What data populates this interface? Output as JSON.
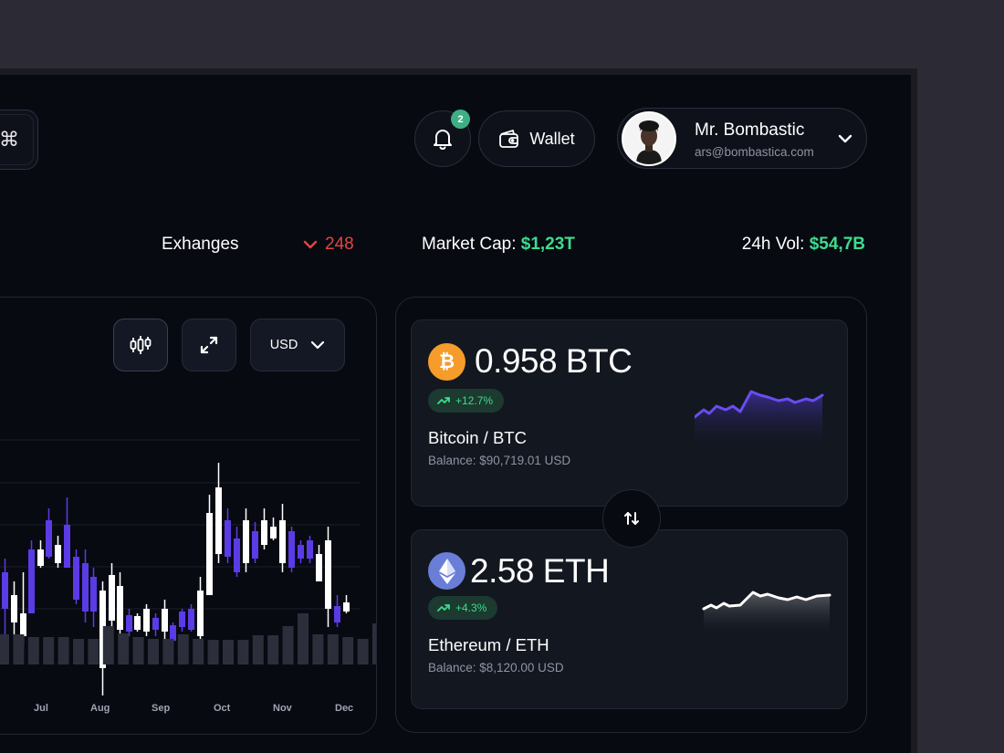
{
  "header": {
    "command_icon": "⌘",
    "notifications": {
      "icon": "bell-icon",
      "count": "2"
    },
    "wallet": {
      "icon": "wallet-icon",
      "label": "Wallet"
    },
    "user": {
      "name": "Mr. Bombastic",
      "email": "ars@bombastica.com",
      "icon": "chevron-down-icon"
    }
  },
  "stats": {
    "exchanges_label": "Exhanges",
    "exchanges_value": "248",
    "exchanges_trend": "down",
    "market_cap_label": "Market Cap:",
    "market_cap_value": "$1,23T",
    "volume_label": "24h Vol:",
    "volume_value": "$54,7B"
  },
  "chart_toolbar": {
    "chart_type_icon": "candlestick-icon",
    "expand_icon": "expand-icon",
    "currency": "USD"
  },
  "chart_data": {
    "type": "candlestick",
    "categories": [
      "Jul",
      "Aug",
      "Sep",
      "Oct",
      "Nov",
      "Dec"
    ],
    "colors": {
      "up": "#ffffff",
      "down": "#5b3be6",
      "volume": "#2c2f3b"
    }
  },
  "coins": [
    {
      "amount": "0.958 BTC",
      "change": "+12.7%",
      "pair": "Bitcoin / BTC",
      "balance": "Balance: $90,719.01 USD",
      "icon": "bitcoin-icon",
      "symbol": "₿",
      "color": "#f59c2a",
      "spark_color": "#6a4cf0"
    },
    {
      "amount": "2.58 ETH",
      "change": "+4.3%",
      "pair": "Ethereum / ETH",
      "balance": "Balance: $8,120.00 USD",
      "icon": "ethereum-icon",
      "color": "#6a7ed8",
      "spark_color": "#ffffff"
    }
  ],
  "swap": {
    "icon": "swap-arrows-icon"
  }
}
